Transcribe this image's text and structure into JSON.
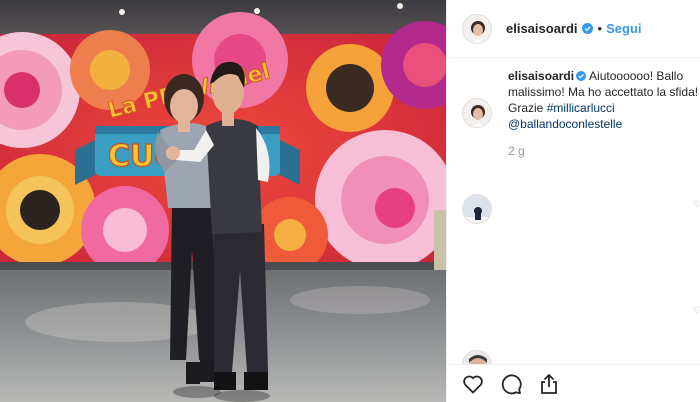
{
  "post": {
    "username": "elisaisoardi",
    "separator": "•",
    "follow_label": "Segui",
    "caption_username": "elisaisoardi",
    "caption_text": "Aiutoooooo! Ballo malissimo! Ma ho accettato la sfida! Grazie ",
    "hashtag": "#millicarlucci",
    "mention": "@ballandoconlestelle",
    "time_ago": "2 g"
  },
  "photo": {
    "show_sign_line1": "La PROVA del",
    "show_sign_line2": "CUOCO"
  },
  "colors": {
    "follow_blue": "#3897f0",
    "link_navy": "#003569",
    "text_dark": "#262626",
    "muted_gray": "#999999",
    "border": "#efefef"
  },
  "icons": {
    "verified": "verified-badge-icon",
    "like": "heart-icon",
    "comment": "comment-bubble-icon",
    "share": "share-icon"
  }
}
